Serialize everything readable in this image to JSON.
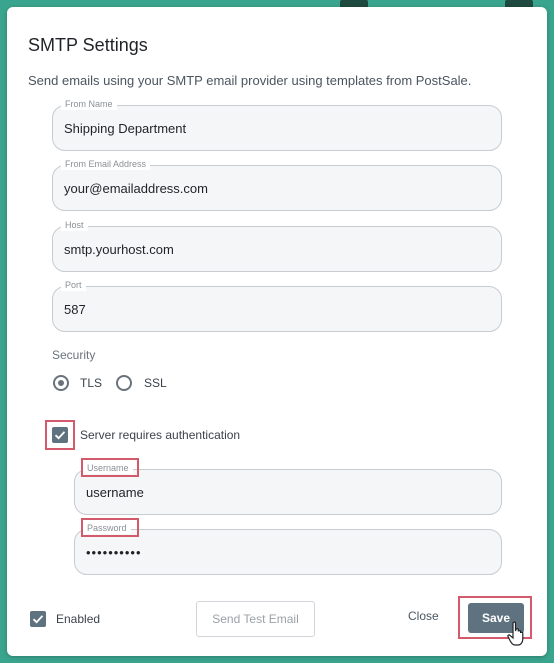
{
  "dialog": {
    "title": "SMTP Settings",
    "description": "Send emails using your SMTP email provider using templates from PostSale."
  },
  "fields": {
    "from_name": {
      "label": "From Name",
      "value": "Shipping Department"
    },
    "from_email": {
      "label": "From Email Address",
      "value": "your@emailaddress.com"
    },
    "host": {
      "label": "Host",
      "value": "smtp.yourhost.com"
    },
    "port": {
      "label": "Port",
      "value": "587"
    }
  },
  "security": {
    "label": "Security",
    "options": [
      "TLS",
      "SSL"
    ],
    "selected": "TLS"
  },
  "auth": {
    "label": "Server requires authentication",
    "checked": true,
    "username": {
      "label": "Username",
      "value": "username"
    },
    "password": {
      "label": "Password",
      "value": "••••••••••"
    }
  },
  "footer": {
    "enabled_label": "Enabled",
    "enabled_checked": true,
    "send_test_label": "Send Test Email",
    "close_label": "Close",
    "save_label": "Save"
  },
  "colors": {
    "backdrop": "#3aa58e",
    "primary_button": "#5f7280",
    "highlight": "#d35a6a"
  }
}
